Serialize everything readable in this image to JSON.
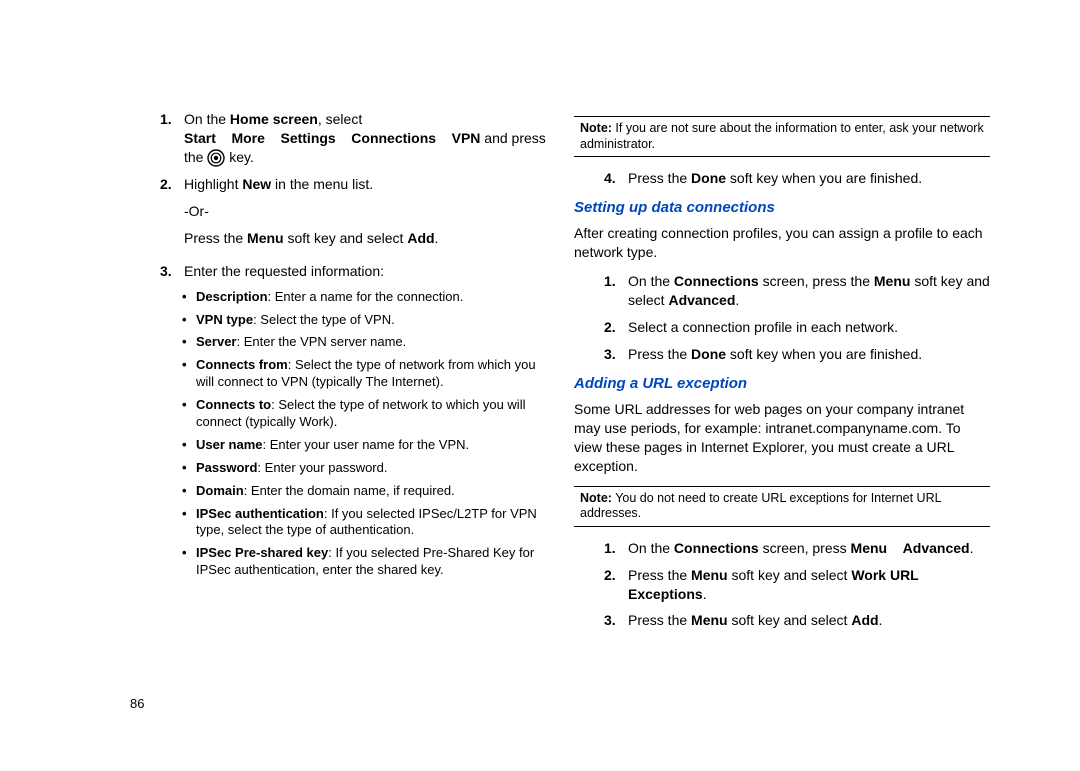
{
  "left": {
    "step1": {
      "num": "1.",
      "t1": "On the ",
      "b1": "Home screen",
      "t2": ", select ",
      "b2": "Start",
      "b3": "More",
      "b4": "Settings",
      "b5": "Connections",
      "b6": "VPN",
      "t3": " and press the ",
      "t4": " key."
    },
    "step2": {
      "num": "2.",
      "t1": "Highlight ",
      "b1": "New",
      "t2": " in the menu list.",
      "or": "-Or-",
      "t3": "Press the ",
      "b2": "Menu",
      "t4": " soft key and select ",
      "b3": "Add",
      "t5": "."
    },
    "step3": {
      "num": "3.",
      "t1": "Enter the requested information:"
    },
    "bullets": {
      "desc": {
        "b": "Description",
        "t": ": Enter a name for the connection."
      },
      "vpntype": {
        "b": "VPN type",
        "t": ": Select the type of VPN."
      },
      "server": {
        "b": "Server",
        "t": ": Enter the VPN server name."
      },
      "connfrom": {
        "b": "Connects from",
        "t": ": Select the type of network from which you will connect to VPN (typically The Internet)."
      },
      "connto": {
        "b": "Connects to",
        "t": ": Select the type of network to which you will connect (typically Work)."
      },
      "username": {
        "b": "User name",
        "t": ": Enter your user name for the VPN."
      },
      "password": {
        "b": "Password",
        "t": ": Enter your password."
      },
      "domain": {
        "b": "Domain",
        "t": ": Enter the domain name, if required."
      },
      "ipsecauth": {
        "b": "IPSec authentication",
        "t": ": If you selected IPSec/L2TP for VPN type, select the type of authentication."
      },
      "ipsecpsk": {
        "b": "IPSec Pre-shared key",
        "t": ": If you selected Pre-Shared Key for IPSec authentication, enter the shared key."
      }
    }
  },
  "right": {
    "note1": {
      "b": "Note:",
      "t": " If you are not sure about the information to enter, ask your network administrator."
    },
    "step4": {
      "num": "4.",
      "t1": "Press the ",
      "b1": "Done",
      "t2": " soft key when you are finished."
    },
    "head1": "Setting up data connections",
    "para1": "After creating connection profiles, you can assign a profile to each network type.",
    "s1_1": {
      "num": "1.",
      "t1": "On the ",
      "b1": "Connections",
      "t2": " screen, press the ",
      "b2": "Menu",
      "t3": " soft key and select ",
      "b3": "Advanced",
      "t4": "."
    },
    "s1_2": {
      "num": "2.",
      "t": "Select a connection profile in each network."
    },
    "s1_3": {
      "num": "3.",
      "t1": "Press the ",
      "b1": "Done",
      "t2": " soft key when you are finished."
    },
    "head2": "Adding a URL exception",
    "para2": "Some URL addresses for web pages on your company intranet may use periods, for example: intranet.companyname.com. To view these pages in Internet Explorer, you must create a URL exception.",
    "note2": {
      "b": "Note:",
      "t": " You do not need to create URL exceptions for Internet URL addresses."
    },
    "s2_1": {
      "num": "1.",
      "t1": "On the ",
      "b1": "Connections",
      "t2": " screen, press ",
      "b2": "Menu",
      "b3": "Advanced",
      "t3": "."
    },
    "s2_2": {
      "num": "2.",
      "t1": "Press the ",
      "b1": "Menu",
      "t2": " soft key and select ",
      "b2": "Work URL Exceptions",
      "t3": "."
    },
    "s2_3": {
      "num": "3.",
      "t1": "Press the ",
      "b1": "Menu",
      "t2": " soft key and select ",
      "b2": "Add",
      "t3": "."
    }
  },
  "page": "86"
}
